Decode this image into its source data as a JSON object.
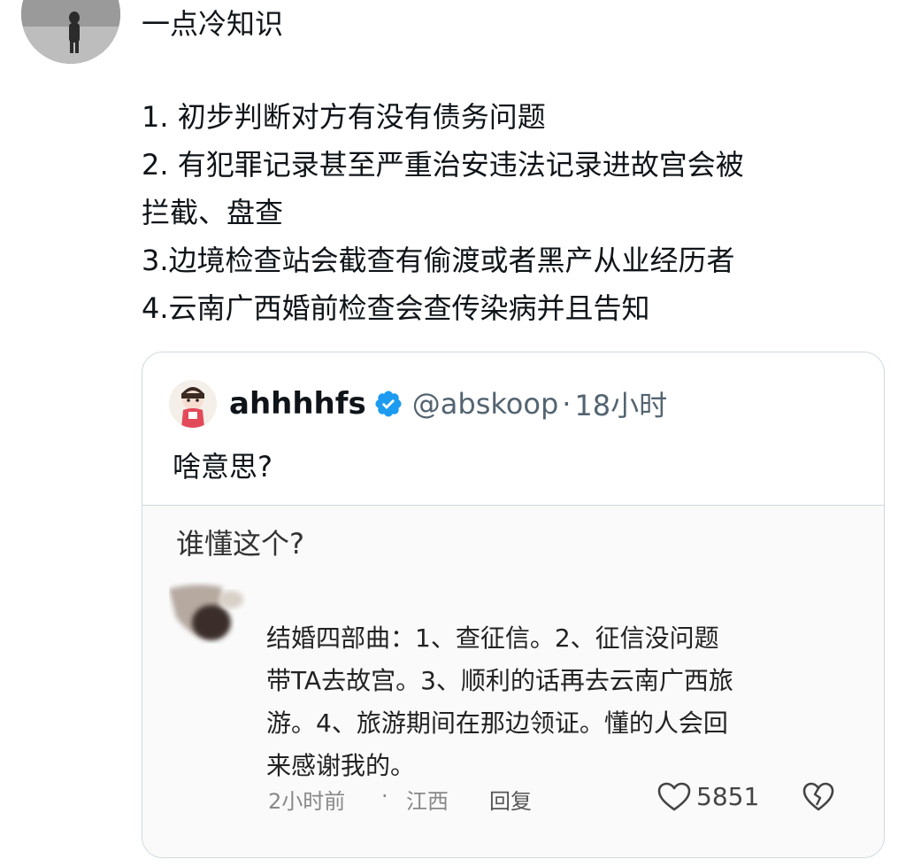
{
  "post": {
    "title": "一点冷知识",
    "lines": [
      "1.  初步判断对方有没有债务问题",
      "2. 有犯罪记录甚至严重治安违法记录进故宫会被",
      "拦截、盘查",
      "3.边境检查站会截查有偷渡或者黑产从业经历者",
      "4.云南广西婚前检查会查传染病并且告知"
    ]
  },
  "quote": {
    "name": "ahhhhfs",
    "handle": "@abskoop",
    "dot": "·",
    "time": "18小时",
    "body": "啥意思?",
    "media": {
      "question": "谁懂这个?",
      "comment_lines": [
        "结婚四部曲：1、查征信。2、征信没问题",
        "带TA去故宫。3、顺利的话再去云南广西旅",
        "游。4、旅游期间在那边领证。懂的人会回",
        "来感谢我的。"
      ],
      "time": "2小时前",
      "sep": "·",
      "location": "江西",
      "reply": "回复",
      "likes": "5851"
    }
  },
  "colors": {
    "text": "#0f1419",
    "secondary": "#536471",
    "border": "#cfd9de",
    "verified": "#1d9bf0"
  }
}
